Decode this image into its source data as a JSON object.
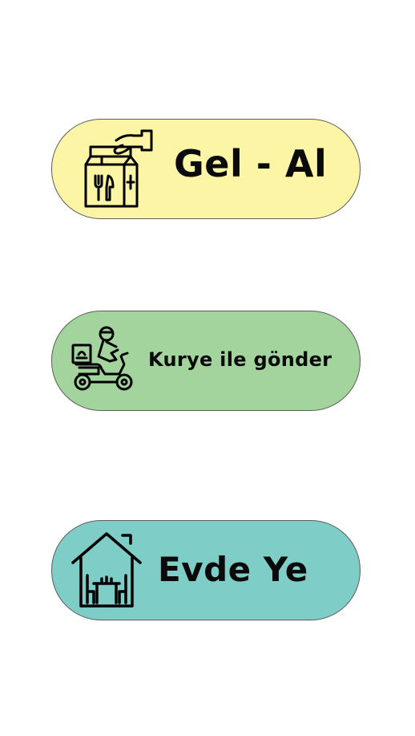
{
  "colors": {
    "pickup_bg": "#fdf5a6",
    "courier_bg": "#a4d49e",
    "dinein_bg": "#7ecdc7",
    "border": "#5c5c5c",
    "text": "#0a0a0a"
  },
  "options": [
    {
      "label": "Gel - Al",
      "icon": "takeaway-bag-icon"
    },
    {
      "label": "Kurye ile gönder",
      "icon": "courier-scooter-icon"
    },
    {
      "label": "Evde Ye",
      "icon": "house-dining-icon"
    }
  ]
}
